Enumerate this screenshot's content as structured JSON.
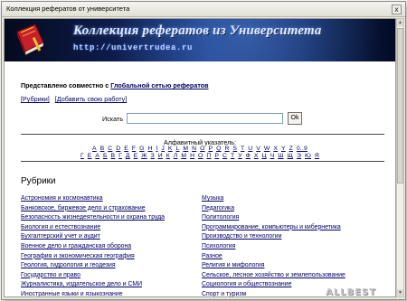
{
  "window": {
    "title": "Коллекция рефератов от университета",
    "close_glyph": "x"
  },
  "banner": {
    "title": "Коллекция рефератов из Университета",
    "url": "http://univertrudea.ru"
  },
  "intro": {
    "text": "Представлено совместно с ",
    "link": "Глобальной сетью рефератов"
  },
  "toplinks": {
    "rubrics": "[Рубрики]",
    "add_work": "[Добавить свою работу]"
  },
  "search": {
    "label": "Искать",
    "value": "",
    "button": "Ok"
  },
  "alphabet": {
    "title": "Алфавитный указатель:",
    "latin": [
      "A",
      "B",
      "C",
      "D",
      "E",
      "F",
      "G",
      "H",
      "I",
      "J",
      "K",
      "L",
      "M",
      "N",
      "O",
      "P",
      "Q",
      "R",
      "S",
      "T",
      "U",
      "V",
      "W",
      "X",
      "Y",
      "Z",
      "0..9"
    ],
    "cyrillic": [
      "Г",
      "Е",
      "А",
      "Б",
      "В",
      "Г",
      "Д",
      "Е",
      "Ж",
      "З",
      "И",
      "К",
      "Л",
      "М",
      "Н",
      "О",
      "П",
      "Р",
      "С",
      "Т",
      "У",
      "Ф",
      "Х",
      "Ц",
      "Ч",
      "Ш",
      "Щ",
      "Э",
      "Ю",
      "Я"
    ]
  },
  "rubrics": {
    "heading": "Рубрики",
    "left": [
      "Астрономия и космонавтика",
      "Банковское, биржевое дело и страхование",
      "Безопасность жизнедеятельности и охрана труда",
      "Биология и естествознание",
      "Бухгалтерский учет и аудит",
      "Военное дело и гражданская оборона",
      "География и экономическая география",
      "Геология, гидрология и геодезия",
      "Государство и право",
      "Журналистика, издательское дело и СМИ",
      "Иностранные языки и языкознание"
    ],
    "right": [
      "Музыка",
      "Педагогика",
      "Политология",
      "Программирование, компьютеры и кибернетика",
      "Производство и технологии",
      "Психология",
      "Разное",
      "Религия и мифология",
      "Сельское, лесное хозяйство и землепользование",
      "Социология и обществознание",
      "Спорт и туризм"
    ]
  },
  "watermark": "ALLBEST",
  "colors": {
    "link": "#000066",
    "banner_dark": "#0d1c4c",
    "book_red": "#c8202a"
  },
  "icons": {
    "logo": "book-icon",
    "close": "close-icon"
  }
}
